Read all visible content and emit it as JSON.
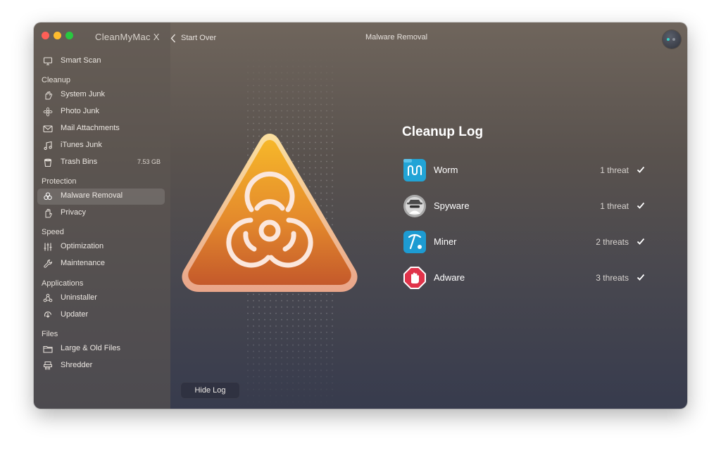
{
  "app": {
    "title": "CleanMyMac X"
  },
  "header": {
    "back_label": "Start Over",
    "title": "Malware Removal"
  },
  "sidebar": {
    "top": {
      "label": "Smart Scan",
      "icon": "monitor-icon"
    },
    "sections": [
      {
        "title": "Cleanup",
        "items": [
          {
            "label": "System Junk",
            "icon": "hand-icon",
            "size": ""
          },
          {
            "label": "Photo Junk",
            "icon": "flower-icon",
            "size": ""
          },
          {
            "label": "Mail Attachments",
            "icon": "mail-icon",
            "size": ""
          },
          {
            "label": "iTunes Junk",
            "icon": "music-icon",
            "size": ""
          },
          {
            "label": "Trash Bins",
            "icon": "trash-icon",
            "size": "7.53 GB"
          }
        ]
      },
      {
        "title": "Protection",
        "items": [
          {
            "label": "Malware Removal",
            "icon": "biohazard-icon",
            "active": true
          },
          {
            "label": "Privacy",
            "icon": "hand-stop-icon"
          }
        ]
      },
      {
        "title": "Speed",
        "items": [
          {
            "label": "Optimization",
            "icon": "sliders-icon"
          },
          {
            "label": "Maintenance",
            "icon": "wrench-icon"
          }
        ]
      },
      {
        "title": "Applications",
        "items": [
          {
            "label": "Uninstaller",
            "icon": "uninstaller-icon"
          },
          {
            "label": "Updater",
            "icon": "updater-icon"
          }
        ]
      },
      {
        "title": "Files",
        "items": [
          {
            "label": "Large & Old Files",
            "icon": "folder-icon"
          },
          {
            "label": "Shredder",
            "icon": "shredder-icon"
          }
        ]
      }
    ]
  },
  "main": {
    "log_title": "Cleanup Log",
    "threats": [
      {
        "name": "Worm",
        "count": "1 threat",
        "icon": "worm-icon"
      },
      {
        "name": "Spyware",
        "count": "1 threat",
        "icon": "spyware-icon"
      },
      {
        "name": "Miner",
        "count": "2 threats",
        "icon": "miner-icon"
      },
      {
        "name": "Adware",
        "count": "3 threats",
        "icon": "adware-icon"
      }
    ],
    "hide_log_label": "Hide Log"
  },
  "colors": {
    "hazard_top": "#f3b12b",
    "hazard_bottom": "#c8612a",
    "worm_icon_bg": "#21a4d6",
    "miner_icon_bg": "#1d9bd2",
    "adware_icon_bg": "#e0334a"
  }
}
